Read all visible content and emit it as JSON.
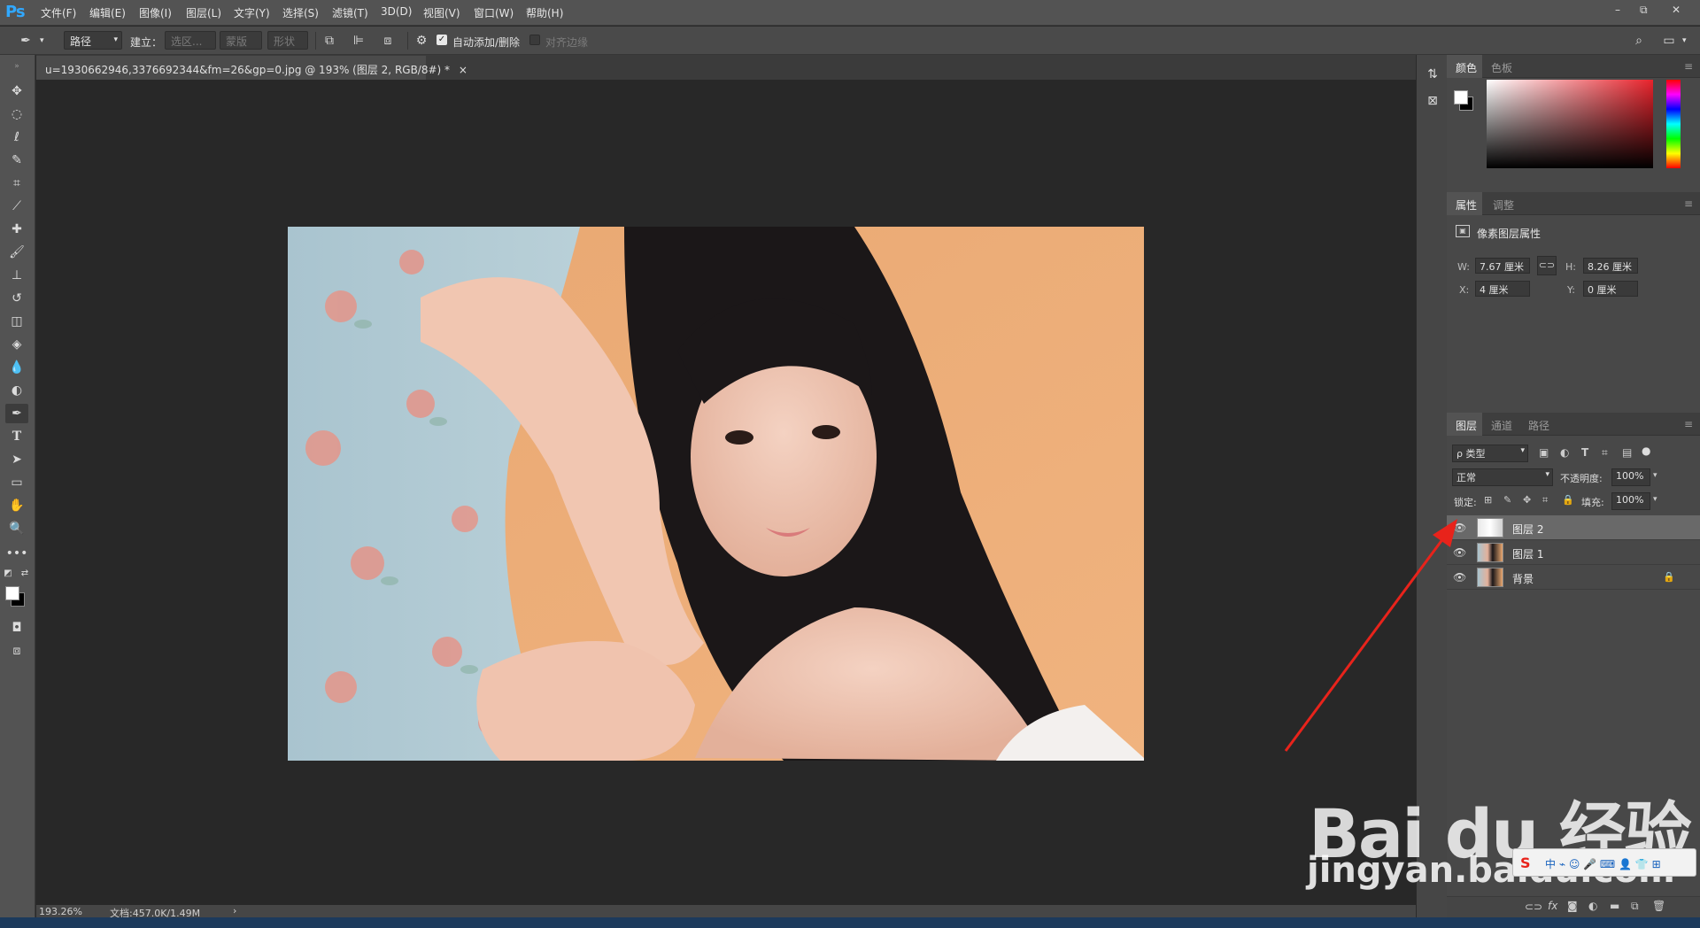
{
  "app": {
    "logo": "Ps"
  },
  "menu": [
    "文件(F)",
    "编辑(E)",
    "图像(I)",
    "图层(L)",
    "文字(Y)",
    "选择(S)",
    "滤镜(T)",
    "3D(D)",
    "视图(V)",
    "窗口(W)",
    "帮助(H)"
  ],
  "window_controls": {
    "minimize": "–",
    "restore": "⧉",
    "close": "✕"
  },
  "options": {
    "mode_select": "路径",
    "build_label": "建立：",
    "selection_btn": "选区...",
    "mask_btn": "蒙版",
    "shape_btn": "形状",
    "auto_add_delete": "自动添加/删除",
    "align_edges": "对齐边缘"
  },
  "document": {
    "tab_title": "u=1930662946,3376692344&fm=26&gp=0.jpg @ 193% (图层 2, RGB/8#) *",
    "tab_close": "×",
    "zoom": "193.26%",
    "doc_size": "文档:457.0K/1.49M",
    "status_arrow": "›"
  },
  "color_panel": {
    "tabs": [
      "颜色",
      "色板"
    ],
    "active": "颜色"
  },
  "properties_panel": {
    "tabs": [
      "属性",
      "调整"
    ],
    "active": "属性",
    "header": "像素图层属性",
    "w_label": "W:",
    "w": "7.67 厘米",
    "h_label": "H:",
    "h": "8.26 厘米",
    "x_label": "X:",
    "x": "4 厘米",
    "y_label": "Y:",
    "y": "0 厘米"
  },
  "layers_panel": {
    "tabs": [
      "图层",
      "通道",
      "路径"
    ],
    "active": "图层",
    "filter_kind": "ρ 类型",
    "blend_mode": "正常",
    "opacity_label": "不透明度:",
    "opacity": "100%",
    "lock_label": "锁定:",
    "fill_label": "填充:",
    "fill": "100%",
    "layers": [
      {
        "name": "图层 2",
        "selected": true,
        "locked": false
      },
      {
        "name": "图层 1",
        "selected": false,
        "locked": false
      },
      {
        "name": "背景",
        "selected": false,
        "locked": true
      }
    ],
    "footer_icons": [
      "link-icon",
      "fx-icon",
      "mask-icon",
      "adjustment-icon",
      "folder-icon",
      "new-layer-icon",
      "trash-icon"
    ]
  },
  "watermark": {
    "brand": "Bai du 经验",
    "url": "jingyan.baidu.com"
  },
  "colors": {
    "annotation_arrow": "#e8231b",
    "ps_blue": "#31a8ff"
  }
}
